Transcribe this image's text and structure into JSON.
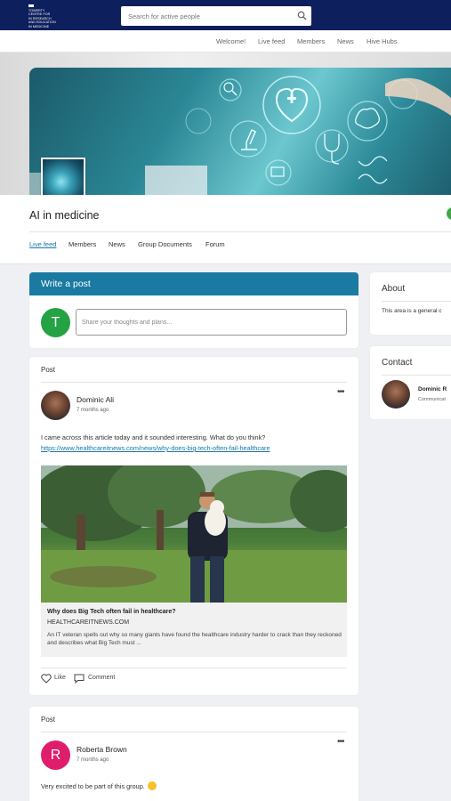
{
  "header": {
    "logo_lines": [
      "TOWERTY",
      "CENTRE FOR",
      "IN RESEARCH",
      "AND EDUCATION",
      "IN MEDICINE"
    ],
    "search_placeholder": "Search for active people"
  },
  "top_nav": {
    "items": [
      "Welcome!",
      "Live feed",
      "Members",
      "News",
      "Hive Hubs"
    ]
  },
  "group": {
    "title": "AI in medicine",
    "tabs": [
      "Live feed",
      "Members",
      "News",
      "Group Documents",
      "Forum"
    ],
    "active_tab": "Live feed"
  },
  "composer": {
    "heading": "Write a post",
    "avatar_initial": "T",
    "placeholder": "Share your thoughts and plans..."
  },
  "sidebar": {
    "about_title": "About",
    "about_text": "This area is a general c",
    "contact_title": "Contact",
    "contact_name": "Dominic R",
    "contact_role": "Communicat"
  },
  "posts": [
    {
      "label": "Post",
      "author": "Dominic Ali",
      "time": "7 months ago",
      "text": "I came across this article today and it sounded interesting. What do you think?",
      "link": "https://www.healthcareitnews.com/news/why-does-big-tech-often-fail-healthcare",
      "preview_title": "Why does Big Tech often fail in healthcare?",
      "preview_domain": "HEALTHCAREITNEWS.COM",
      "preview_desc": "An IT veteran spells out why so many giants have found the healthcare industry harder to crack than they reckoned and describes what Big Tech must ...",
      "like_label": "Like",
      "comment_label": "Comment"
    },
    {
      "label": "Post",
      "author": "Roberta Brown",
      "avatar_initial": "R",
      "time": "7 months ago",
      "text": "Very excited to be part of this group."
    }
  ],
  "colors": {
    "topbar": "#0d1f5c",
    "accent": "#1a7aa2",
    "link": "#1677a7",
    "composer_avatar": "#25a244",
    "post2_avatar": "#e01d6a"
  }
}
